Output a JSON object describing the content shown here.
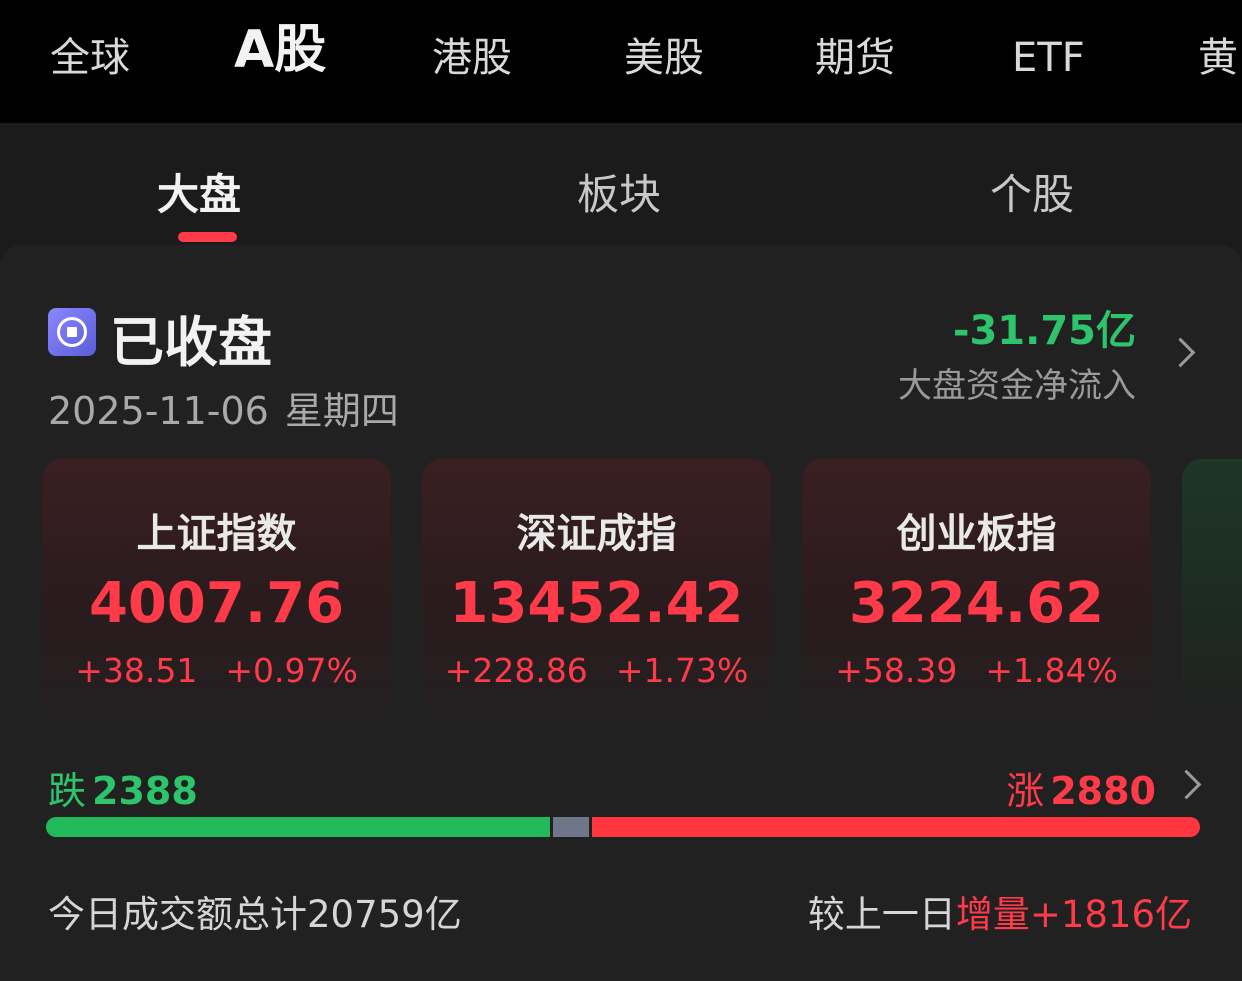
{
  "top_tabs": [
    "全球",
    "A股",
    "港股",
    "美股",
    "期货",
    "ETF",
    "黄"
  ],
  "active_top_tab": "A股",
  "sub_tabs": [
    "大盘",
    "板块",
    "个股"
  ],
  "active_sub_tab": "大盘",
  "market_status": {
    "label": "已收盘",
    "icon": "stop-circle-icon",
    "date": "2025-11-06",
    "weekday": "星期四"
  },
  "net_flow": {
    "value": "-31.75亿",
    "label": "大盘资金净流入"
  },
  "indices": [
    {
      "name": "上证指数",
      "value": "4007.76",
      "change": "+38.51",
      "change_pct": "+0.97%"
    },
    {
      "name": "深证成指",
      "value": "13452.42",
      "change": "+228.86",
      "change_pct": "+1.73%"
    },
    {
      "name": "创业板指",
      "value": "3224.62",
      "change": "+58.39",
      "change_pct": "+1.84%"
    }
  ],
  "breadth": {
    "down_label": "跌",
    "down_count": "2388",
    "up_label": "涨",
    "up_count": "2880"
  },
  "turnover": {
    "text": "今日成交额总计20759亿",
    "compare_prefix": "较上一日",
    "compare_kind": "增量",
    "compare_value": "+1816亿"
  },
  "colors": {
    "up": "#ff3b4a",
    "down": "#2ec46c",
    "flat": "#6f7689",
    "background": "#1b1b1b"
  }
}
